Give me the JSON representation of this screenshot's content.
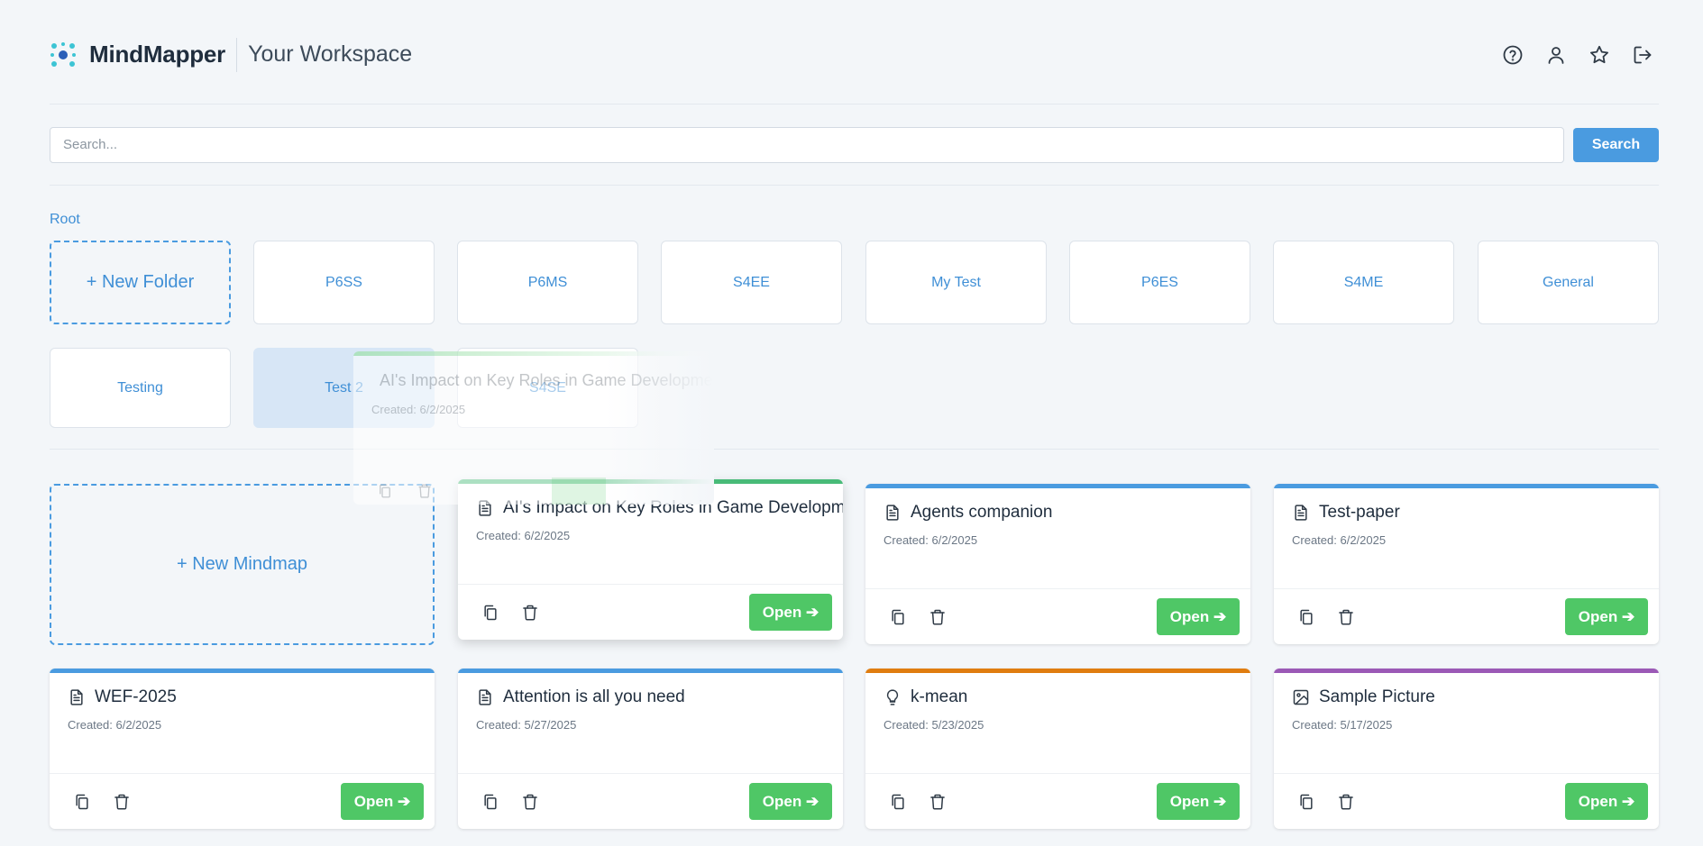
{
  "header": {
    "app_name": "MindMapper",
    "subtitle": "Your Workspace",
    "icons": [
      "help-icon",
      "user-icon",
      "star-icon",
      "logout-icon"
    ]
  },
  "search": {
    "placeholder": "Search...",
    "value": "",
    "button_label": "Search"
  },
  "breadcrumb": "Root",
  "folders": {
    "new_label": "+ New Folder",
    "items": [
      "P6SS",
      "P6MS",
      "S4EE",
      "My Test",
      "P6ES",
      "S4ME",
      "General",
      "Testing",
      "Test 2",
      "S4SE"
    ],
    "selected": "Test 2"
  },
  "mindmaps": {
    "new_label": "+ New Mindmap",
    "open_label": "Open ➔",
    "items": [
      {
        "title": "AI's Impact on Key Roles in Game Development",
        "created": "Created: 6/2/2025",
        "icon": "document-icon",
        "color": "#48bb78"
      },
      {
        "title": "Agents companion",
        "created": "Created: 6/2/2025",
        "icon": "document-icon",
        "color": "#4a9be0"
      },
      {
        "title": "Test-paper",
        "created": "Created: 6/2/2025",
        "icon": "document-icon",
        "color": "#4a9be0"
      },
      {
        "title": "WEF-2025",
        "created": "Created: 6/2/2025",
        "icon": "document-icon",
        "color": "#4a9be0"
      },
      {
        "title": "Attention is all you need",
        "created": "Created: 5/27/2025",
        "icon": "document-icon",
        "color": "#4a9be0"
      },
      {
        "title": "k-mean",
        "created": "Created: 5/23/2025",
        "icon": "lightbulb-icon",
        "color": "#e07d10"
      },
      {
        "title": "Sample Picture",
        "created": "Created: 5/17/2025",
        "icon": "image-icon",
        "color": "#9b59b6"
      }
    ]
  },
  "drag_ghost": {
    "title": "AI's Impact on Key Roles in Game Development",
    "created": "Created: 6/2/2025"
  }
}
